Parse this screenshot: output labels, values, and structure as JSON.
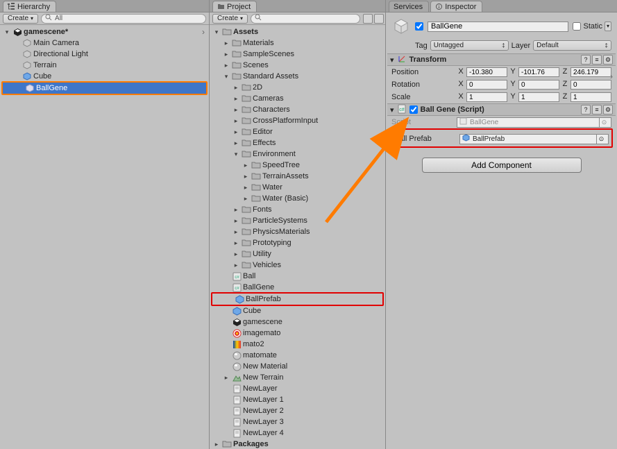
{
  "hierarchy": {
    "tab": "Hierarchy",
    "create": "Create",
    "search_placeholder": "All",
    "root": "gamescene*",
    "items": [
      "Main Camera",
      "Directional Light",
      "Terrain",
      "Cube",
      "BallGene"
    ]
  },
  "project": {
    "tab": "Project",
    "create": "Create",
    "assets": "Assets",
    "packages": "Packages",
    "folders_l1": [
      "Materials",
      "SampleScenes",
      "Scenes"
    ],
    "standard_assets": "Standard Assets",
    "sa_items_top": [
      "2D",
      "Cameras",
      "Characters",
      "CrossPlatformInput",
      "Editor",
      "Effects"
    ],
    "environment": "Environment",
    "env_items": [
      "SpeedTree",
      "TerrainAssets",
      "Water",
      "Water (Basic)"
    ],
    "sa_items_bottom": [
      "Fonts",
      "ParticleSystems",
      "PhysicsMaterials",
      "Prototyping",
      "Utility",
      "Vehicles"
    ],
    "files": [
      "Ball",
      "BallGene",
      "BallPrefab",
      "Cube",
      "gamescene",
      "imagemato",
      "mato2",
      "matomate",
      "New Material",
      "New Terrain",
      "NewLayer",
      "NewLayer 1",
      "NewLayer 2",
      "NewLayer 3",
      "NewLayer 4"
    ]
  },
  "inspector": {
    "tab_services": "Services",
    "tab_inspector": "Inspector",
    "object_name": "BallGene",
    "static_label": "Static",
    "tag_label": "Tag",
    "tag_value": "Untagged",
    "layer_label": "Layer",
    "layer_value": "Default",
    "transform": {
      "title": "Transform",
      "position_label": "Position",
      "rotation_label": "Rotation",
      "scale_label": "Scale",
      "x": "X",
      "y": "Y",
      "z": "Z",
      "position": {
        "x": "-10.380",
        "y": "-101.76",
        "z": "246.179"
      },
      "rotation": {
        "x": "0",
        "y": "0",
        "z": "0"
      },
      "scale": {
        "x": "1",
        "y": "1",
        "z": "1"
      }
    },
    "script": {
      "title": "Ball Gene (Script)",
      "script_label": "Script",
      "script_value": "BallGene",
      "prefab_label": "Ball Prefab",
      "prefab_value": "BallPrefab"
    },
    "add_component": "Add Component"
  }
}
